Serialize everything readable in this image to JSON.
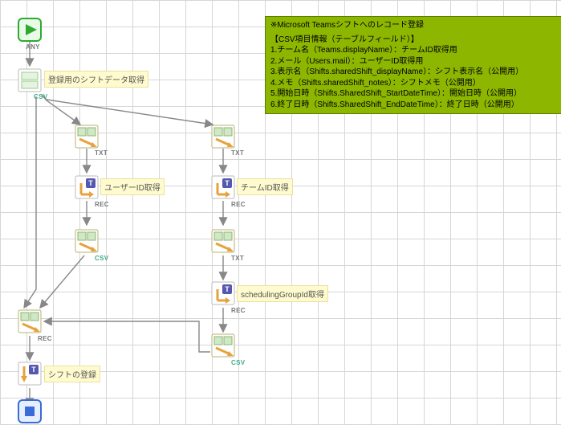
{
  "info_box": {
    "title": "※Microsoft Teamsシフトへのレコード登録",
    "section": "【CSV項目情報（テーブルフィールド）】",
    "l1": "1.チーム名（Teams.displayName）：チームID取得用",
    "l2": "2.メール（Users.mail）：ユーザーID取得用",
    "l3": "3.表示名（Shifts.sharedShift_displayName）：シフト表示名（公開用）",
    "l4": "4.メモ（Shifts.sharedShift_notes）：シフトメモ（公開用）",
    "l5": "5.開始日時（Shifts.SharedShift_StartDateTime）：開始日時（公開用）",
    "l6": "6.終了日時（Shifts.SharedShift_EndDateTime）：終了日時（公開用）"
  },
  "notes": {
    "load_csv": "登録用のシフトデータ取得",
    "user_id": "ユーザーID取得",
    "team_id": "チームID取得",
    "sched_id": "schedulingGroupId取得",
    "register": "シフトの登録"
  },
  "ports": {
    "any": "ANY",
    "csv": "CSV",
    "txt": "TXT",
    "rec": "REC"
  }
}
